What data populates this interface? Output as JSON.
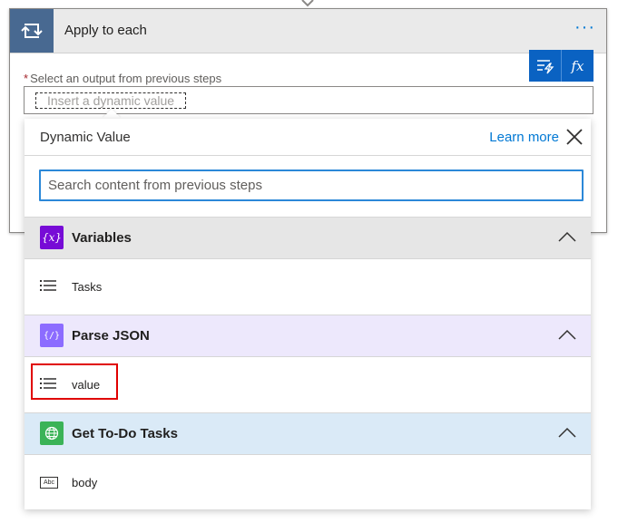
{
  "card": {
    "title": "Apply to each",
    "more_label": "···",
    "field_label": "Select an output from previous steps",
    "required_mark": "*",
    "token_placeholder": "Insert a dynamic value",
    "toolbar": {
      "dynamic_icon": "dynamic-content-icon",
      "fx_label": "fx"
    }
  },
  "panel": {
    "title": "Dynamic Value",
    "learn_more": "Learn more",
    "search_placeholder": "Search content from previous steps",
    "groups": [
      {
        "label": "Variables",
        "icon": "variables-icon",
        "icon_text": "{x}",
        "color": "#770bd6",
        "header_bg": "#e6e6e6",
        "items": [
          {
            "label": "Tasks",
            "icon": "array-icon"
          }
        ]
      },
      {
        "label": "Parse JSON",
        "icon": "parse-json-icon",
        "icon_text": "{/}",
        "color": "#8c6cff",
        "header_bg": "#ede8fc",
        "items": [
          {
            "label": "value",
            "icon": "array-icon"
          }
        ]
      },
      {
        "label": "Get To-Do Tasks",
        "icon": "globe-icon",
        "icon_text": "",
        "color": "#3bb357",
        "header_bg": "#daeaf7",
        "items": [
          {
            "label": "body",
            "icon": "text-icon",
            "icon_text": "Abc"
          }
        ]
      }
    ]
  },
  "colors": {
    "accent": "#0078d4",
    "loop_tile": "#486991",
    "toolbar": "#0a62c2",
    "highlight": "#e00000"
  }
}
